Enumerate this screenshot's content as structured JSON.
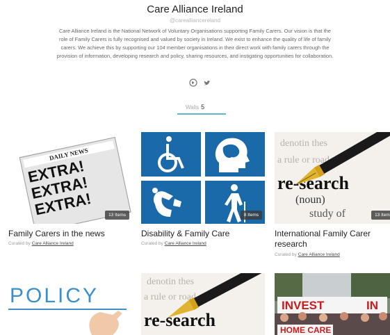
{
  "profile": {
    "title": "Care Alliance Ireland",
    "handle": "@carealliancereland",
    "description": "Care Alliance Ireland is the National Network of Voluntary Organisations supporting Family Carers. Our vision is that the role of Family Carers is fully recognised and valued by society in Ireland. We exist to enhance the quality of life of family carers. We achieve this by supporting our 104 member organisations in their direct work with family carers through the provision of information, developing research and policy, sharing resources, and instigating opportunities for collaboration."
  },
  "social_icons": [
    "globe-icon",
    "twitter-icon"
  ],
  "stats": {
    "label": "Walls",
    "count": "5"
  },
  "cards": [
    {
      "title": "Family Carers in the news",
      "badge": "13 Items",
      "curated_label": "Curated by",
      "curator": "Care Alliance Ireland",
      "image": "newspaper",
      "image_text": [
        "DAILY NEWS",
        "EXTRA!",
        "EXTRA!",
        "EXTRA!"
      ]
    },
    {
      "title": "Disability & Family Care",
      "badge": "8 Items",
      "curated_label": "Curated by",
      "curator": "Care Alliance Ireland",
      "image": "disability-icons"
    },
    {
      "title": "International Family Carer research",
      "badge": "13 Items",
      "curated_label": "Curated by",
      "curator": "Care Alliance Ireland",
      "image": "research-pen",
      "image_text": [
        "re-search",
        "(noun)",
        "study of"
      ]
    },
    {
      "title": "",
      "badge": "",
      "image": "policy",
      "image_text": [
        "POLICY"
      ]
    },
    {
      "title": "",
      "badge": "",
      "image": "research-pen",
      "image_text": [
        "re-search"
      ]
    },
    {
      "title": "",
      "badge": "",
      "image": "protest",
      "image_text": [
        "INVEST",
        "IN",
        "HOME CARE"
      ]
    }
  ],
  "colors": {
    "accent": "#5fb6c9",
    "disability_blue": "#1a6aa9"
  }
}
